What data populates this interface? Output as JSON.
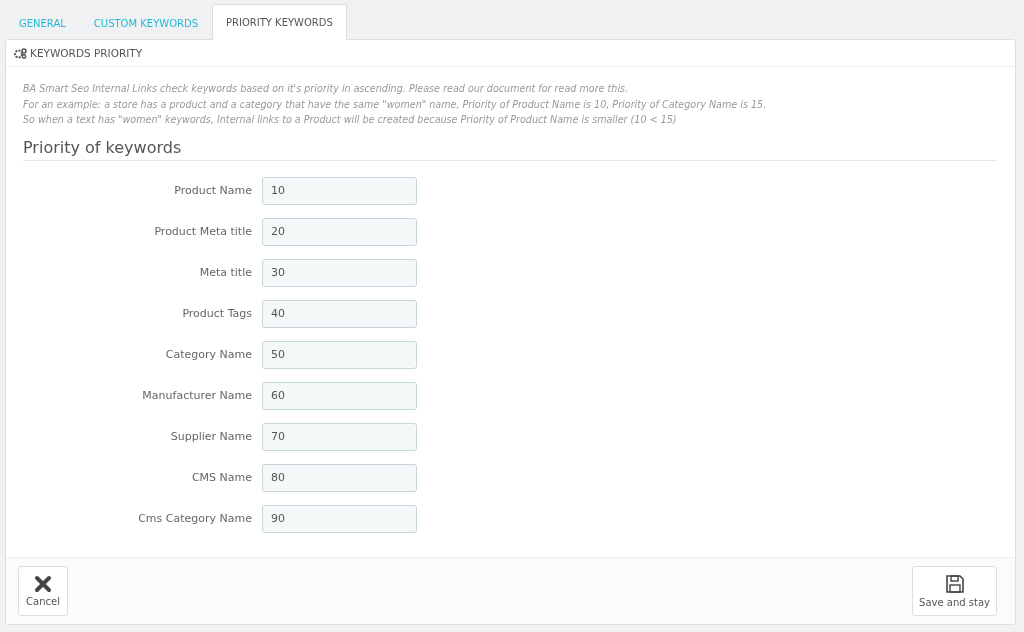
{
  "tabs": [
    {
      "label": "GENERAL",
      "selected": false
    },
    {
      "label": "CUSTOM KEYWORDS",
      "selected": false
    },
    {
      "label": "PRIORITY KEYWORDS",
      "selected": true
    }
  ],
  "panel": {
    "title": "KEYWORDS PRIORITY",
    "description": [
      "BA Smart Seo Internal Links check keywords based on it's priority in ascending. Please read our document for read more this.",
      "For an example: a store has a product and a category that have the same \"women\" name, Priority of Product Name is 10, Priority of Category Name is 15.",
      "So when a text has \"women\" keywords, Internal links to a Product will be created because Priority of Product Name is smaller (10 < 15)"
    ],
    "section_title": "Priority of keywords",
    "fields": [
      {
        "label": "Product Name",
        "value": "10"
      },
      {
        "label": "Product Meta title",
        "value": "20"
      },
      {
        "label": "Meta title",
        "value": "30"
      },
      {
        "label": "Product Tags",
        "value": "40"
      },
      {
        "label": "Category Name",
        "value": "50"
      },
      {
        "label": "Manufacturer Name",
        "value": "60"
      },
      {
        "label": "Supplier Name",
        "value": "70"
      },
      {
        "label": "CMS Name",
        "value": "80"
      },
      {
        "label": "Cms Category Name",
        "value": "90"
      }
    ],
    "buttons": [
      {
        "kind": "cancel",
        "label": "Cancel"
      },
      {
        "kind": "save",
        "label": "Save and stay"
      }
    ]
  }
}
